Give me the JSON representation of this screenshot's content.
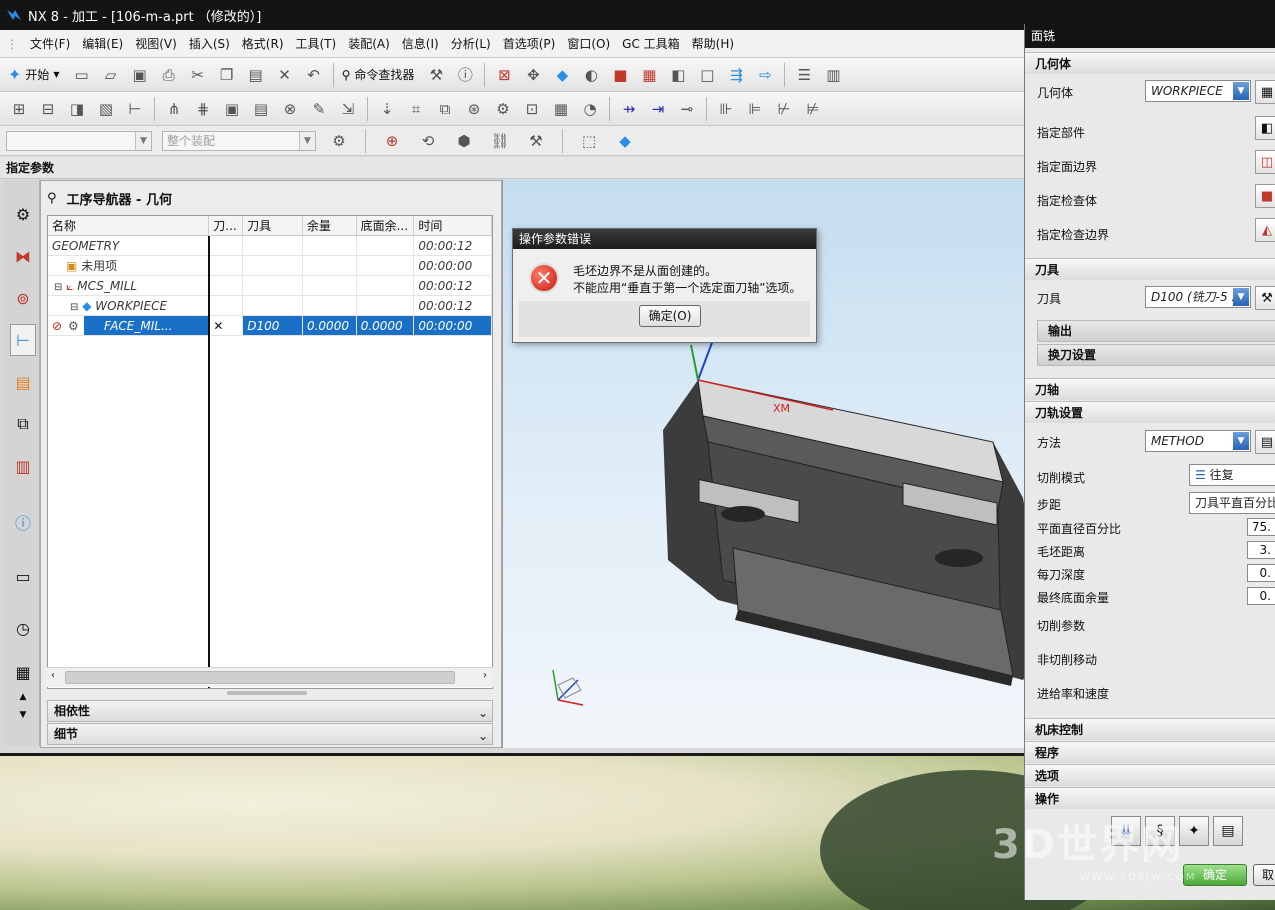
{
  "window": {
    "title": "NX 8 - 加工 - [106-m-a.prt （修改的）]"
  },
  "menu": [
    "文件(F)",
    "编辑(E)",
    "视图(V)",
    "插入(S)",
    "格式(R)",
    "工具(T)",
    "装配(A)",
    "信息(I)",
    "分析(L)",
    "首选项(P)",
    "窗口(O)",
    "GC 工具箱",
    "帮助(H)"
  ],
  "toolbar": {
    "start_label": "开始",
    "command_finder_label": "命令查找器"
  },
  "filter": {
    "selection_placeholder": "",
    "scope_label": "整个装配"
  },
  "param_header": "指定参数",
  "navigator": {
    "title": "工序导航器 - 几何",
    "columns": [
      "名称",
      "刀...",
      "刀具",
      "余量",
      "底面余...",
      "时间"
    ],
    "rows": [
      {
        "name": "GEOMETRY",
        "tool": "",
        "stock": "",
        "floor": "",
        "time": "00:00:12"
      },
      {
        "name": "未用项",
        "tool": "",
        "stock": "",
        "floor": "",
        "time": "00:00:00"
      },
      {
        "name": "MCS_MILL",
        "tool": "",
        "stock": "",
        "floor": "",
        "time": "00:00:12"
      },
      {
        "name": "WORKPIECE",
        "tool": "",
        "stock": "",
        "floor": "",
        "time": "00:00:12"
      },
      {
        "name": "FACE_MIL...",
        "tool": "D100",
        "stock": "0.0000",
        "floor": "0.0000",
        "time": "00:00:00"
      }
    ],
    "dependency_label": "相依性",
    "details_label": "细节"
  },
  "viewport": {
    "axis_label": "XM"
  },
  "error_dialog": {
    "title": "操作参数错误",
    "line1": "毛坯边界不是从面创建的。",
    "line2": "不能应用“垂直于第一个选定面刀轴”选项。",
    "ok_label": "确定(O)"
  },
  "face_mill": {
    "title": "面铣",
    "geometry_section": "几何体",
    "geometry_label": "几何体",
    "geometry_value": "WORKPIECE",
    "specify_part": "指定部件",
    "specify_face_boundary": "指定面边界",
    "specify_check_body": "指定检查体",
    "specify_check_boundary": "指定检查边界",
    "tool_section": "刀具",
    "tool_label": "刀具",
    "tool_value": "D100 (铣刀-5 :",
    "output_label": "输出",
    "tool_change_label": "换刀设置",
    "axis_section": "刀轴",
    "path_settings_section": "刀轨设置",
    "method_label": "方法",
    "method_value": "METHOD",
    "cut_pattern_label": "切削模式",
    "cut_pattern_value": "往复",
    "stepover_label": "步距",
    "stepover_value": "刀具平直百分比",
    "flat_diameter_label": "平面直径百分比",
    "flat_diameter_value": "75.",
    "blank_distance_label": "毛坯距离",
    "blank_distance_value": "3.",
    "depth_per_cut_label": "每刀深度",
    "depth_per_cut_value": "0.",
    "final_floor_stock_label": "最终底面余量",
    "final_floor_stock_value": "0.",
    "cutting_params_label": "切削参数",
    "non_cutting_label": "非切削移动",
    "feeds_speeds_label": "进给率和速度",
    "machine_control_section": "机床控制",
    "program_section": "程序",
    "options_section": "选项",
    "actions_section": "操作",
    "ok_label": "确定",
    "cancel_label": "取"
  },
  "watermark": {
    "brand": "3D世界网",
    "url": "WWW.3DSJW.COM"
  },
  "colors": {
    "selection": "#1a70c6",
    "titlebar": "#141414",
    "error_red": "#c81a10"
  }
}
